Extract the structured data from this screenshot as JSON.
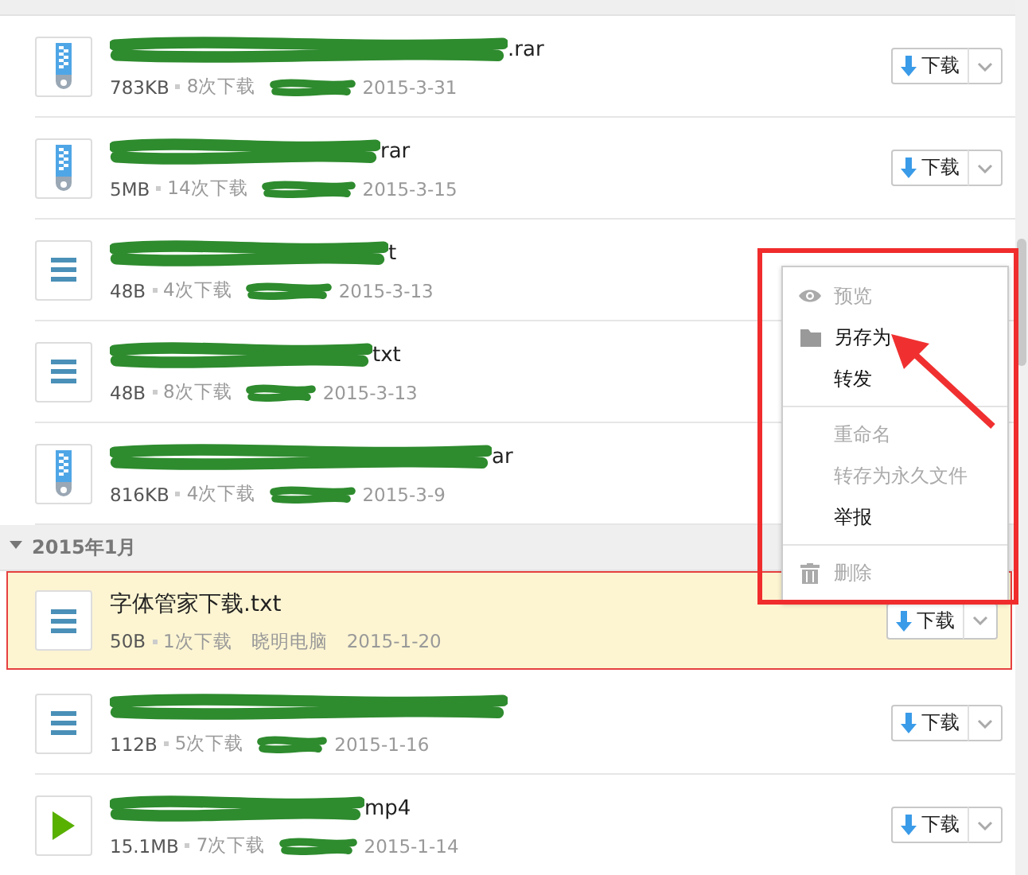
{
  "groups": [
    {
      "files": [
        {
          "kind": "zip",
          "name": ".rar",
          "redacted": true,
          "size": "783KB",
          "downloads": "8次下载",
          "date": "2015-3-31",
          "highlighted": false,
          "button": "下载"
        },
        {
          "kind": "zip",
          "name": "rar",
          "redacted": true,
          "size": "5MB",
          "downloads": "14次下载",
          "date": "2015-3-15",
          "highlighted": false,
          "button": "下载"
        },
        {
          "kind": "text",
          "name": "t",
          "redacted": true,
          "size": "48B",
          "downloads": "4次下载",
          "date": "2015-3-13",
          "highlighted": false
        },
        {
          "kind": "text",
          "name": "txt",
          "redacted": true,
          "size": "48B",
          "downloads": "8次下载",
          "date": "2015-3-13",
          "highlighted": false
        },
        {
          "kind": "zip",
          "name": "ar",
          "redacted": true,
          "size": "816KB",
          "downloads": "4次下载",
          "date": "2015-3-9",
          "highlighted": false
        }
      ]
    },
    {
      "title": "2015年1月",
      "expanded": true,
      "files": [
        {
          "kind": "text",
          "name": "字体管家下载.txt",
          "redacted": false,
          "size": "50B",
          "downloads": "1次下载",
          "uploader": "晓明电脑",
          "date": "2015-1-20",
          "highlighted": true,
          "button": "下载"
        },
        {
          "kind": "text",
          "redacted": true,
          "size": "112B",
          "downloads": "5次下载",
          "date": "2015-1-16",
          "highlighted": false,
          "button": "下载"
        },
        {
          "kind": "video",
          "name": "mp4",
          "redacted": true,
          "size": "15.1MB",
          "downloads": "7次下载",
          "date": "2015-1-14",
          "highlighted": false,
          "button": "下载"
        }
      ]
    }
  ],
  "context_menu": {
    "items": [
      {
        "kind": "item",
        "label": "预览",
        "disabled": true
      },
      {
        "kind": "item",
        "label": "另存为",
        "disabled": false
      },
      {
        "kind": "item",
        "label": "转发",
        "disabled": false
      },
      {
        "kind": "divider"
      },
      {
        "kind": "item",
        "label": "重命名",
        "disabled": true
      },
      {
        "kind": "item",
        "label": "转存为永久文件",
        "disabled": true
      },
      {
        "kind": "item",
        "label": "举报",
        "disabled": false
      },
      {
        "kind": "divider"
      },
      {
        "kind": "item",
        "label": "删除",
        "disabled": true
      }
    ]
  }
}
